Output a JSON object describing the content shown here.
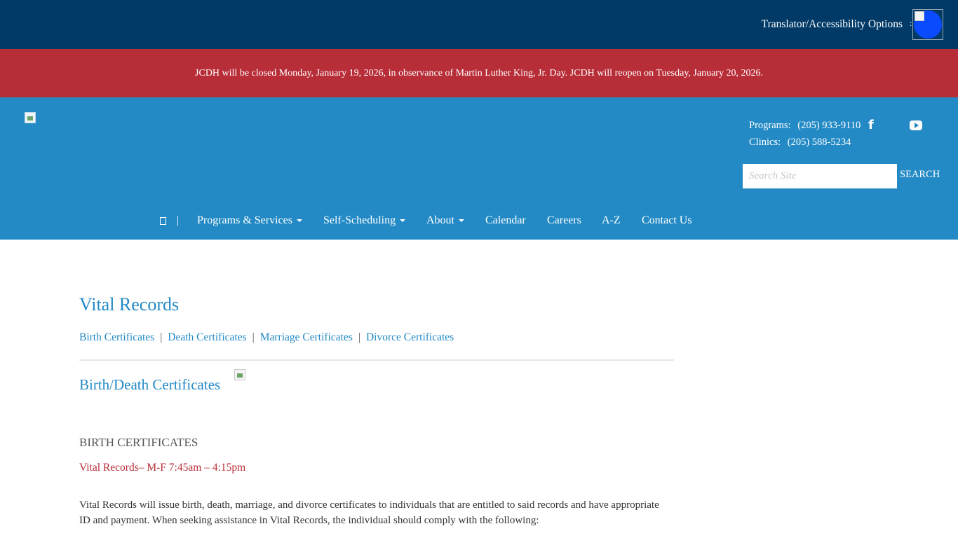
{
  "topbar": {
    "translator_label": "Translator/Accessibility Options",
    "translator_arrow": ":",
    "accessibility_icon": "accessibility-icon",
    "colors": {
      "background": "#013a66",
      "icon": "#0a4bff"
    }
  },
  "alert": {
    "text": "JCDH will be closed Monday, January 19, 2026, in observance of Martin Luther King, Jr. Day. JCDH will reopen on Tuesday, January 20, 2026.",
    "color": "#b82e38"
  },
  "header": {
    "color": "#238ac5",
    "logo": "logo-image",
    "contacts": [
      {
        "label": "Programs:",
        "phone": "(205) 933-9110"
      },
      {
        "label": "Clinics:",
        "phone": "(205) 588-5234"
      }
    ],
    "social": [
      "facebook-icon",
      "youtube-icon"
    ],
    "search": {
      "placeholder": "Search Site",
      "value": "",
      "button_label": "SEARCH"
    }
  },
  "nav": {
    "home_icon": "home-icon",
    "separator": "|",
    "items": [
      {
        "label": "Programs & Services",
        "dropdown": true
      },
      {
        "label": "Self-Scheduling",
        "dropdown": true
      },
      {
        "label": "About",
        "dropdown": true
      },
      {
        "label": "Calendar",
        "dropdown": false
      },
      {
        "label": "Careers",
        "dropdown": false
      },
      {
        "label": "A-Z",
        "dropdown": false
      },
      {
        "label": "Contact Us",
        "dropdown": false
      }
    ]
  },
  "main": {
    "title": "Vital Records",
    "subnav": {
      "separator": "|",
      "links": [
        "Birth Certificates",
        "Death Certificates",
        "Marriage Certificates",
        "Divorce Certificates"
      ]
    },
    "section_title": "Birth/Death Certificates",
    "birth_heading": "BIRTH CERTIFICATES",
    "hours": "Vital Records– M-F 7:45am – 4:15pm",
    "body": "Vital Records will issue birth, death, marriage, and divorce certificates to individuals that are entitled to said records and have appropriate ID and payment. When seeking assistance in Vital Records, the individual should comply with the following:"
  }
}
